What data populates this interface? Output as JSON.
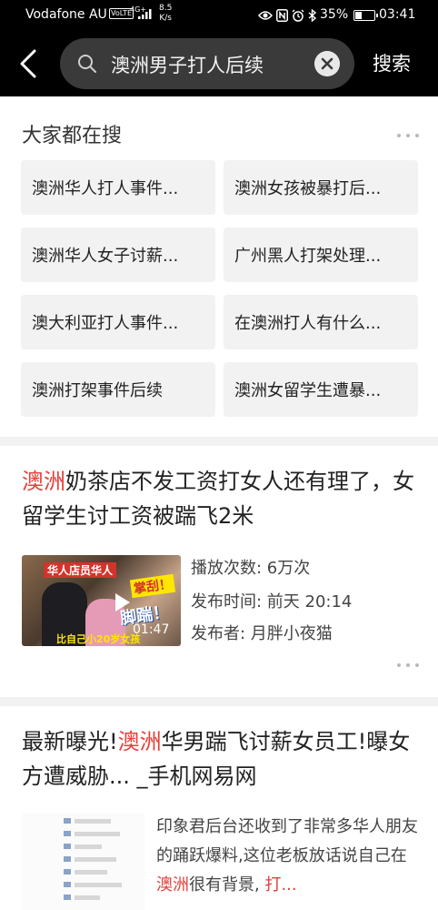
{
  "status_bar": {
    "carrier": "Vodafone AU",
    "volte": "VoLTE",
    "network": "4G+",
    "speed_value": "8.5",
    "speed_unit": "K/s",
    "battery": "35%",
    "battery_level": 0.35,
    "time": "03:41"
  },
  "search": {
    "query": "澳洲男子打人后续",
    "submit_label": "搜索"
  },
  "hot_searches": {
    "title": "大家都在搜",
    "items": [
      "澳洲华人打人事件...",
      "澳洲女孩被暴打后...",
      "澳洲华人女子讨薪...",
      "广州黑人打架处理...",
      "澳大利亚打人事件...",
      "在澳洲打人有什么...",
      "澳洲打架事件后续",
      "澳洲女留学生遭暴..."
    ]
  },
  "results": [
    {
      "title_highlight": "澳洲",
      "title_rest": "奶茶店不发工资打女人还有理了，女留学生讨工资被踹飞2米",
      "thumbnail": {
        "caption_top": "华人店员华人",
        "caption_right": "掌刮！",
        "caption_middle": "脚踹！",
        "caption_bottom": "比自己小20岁女孩",
        "duration": "01:47"
      },
      "views": "播放次数: 6万次",
      "published": "发布时间: 前天 20:14",
      "publisher": "发布者: 月胖小夜猫"
    },
    {
      "title_prefix": "最新曝光!",
      "title_highlight": "澳洲",
      "title_rest": "华男踹飞讨薪女员工!曝女方遭威胁... _手机网易网",
      "snippet_before": "印象君后台还收到了非常多华人朋友的踊跃爆料,这位老板放话说自己在",
      "snippet_highlight_1": "澳洲",
      "snippet_middle": "很有背景, ",
      "snippet_highlight_2": "打...",
      "snippet_after": ""
    }
  ],
  "colors": {
    "highlight": "#e0413a",
    "header_bg": "#000000",
    "chip_bg": "#f2f2f2"
  }
}
